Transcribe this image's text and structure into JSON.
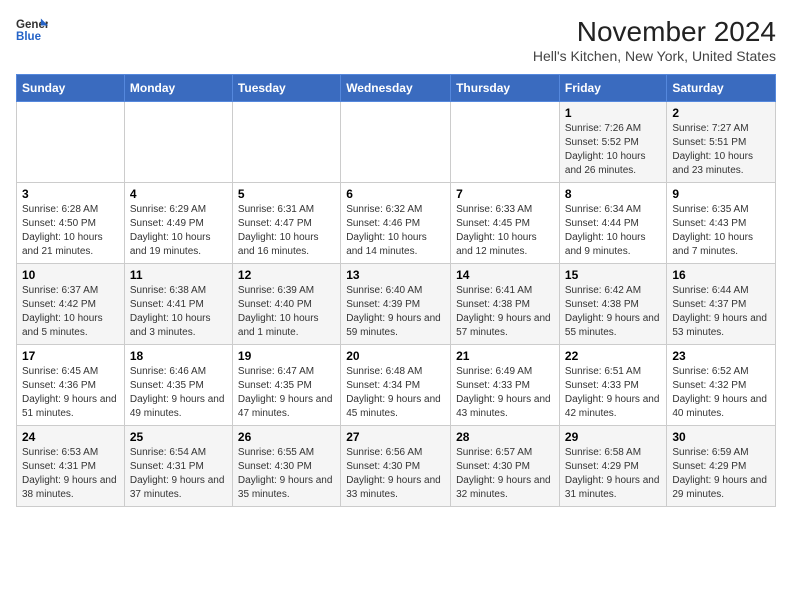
{
  "logo": {
    "line1": "General",
    "line2": "Blue"
  },
  "title": "November 2024",
  "subtitle": "Hell's Kitchen, New York, United States",
  "weekdays": [
    "Sunday",
    "Monday",
    "Tuesday",
    "Wednesday",
    "Thursday",
    "Friday",
    "Saturday"
  ],
  "weeks": [
    [
      {
        "day": "",
        "info": ""
      },
      {
        "day": "",
        "info": ""
      },
      {
        "day": "",
        "info": ""
      },
      {
        "day": "",
        "info": ""
      },
      {
        "day": "",
        "info": ""
      },
      {
        "day": "1",
        "info": "Sunrise: 7:26 AM\nSunset: 5:52 PM\nDaylight: 10 hours and 26 minutes."
      },
      {
        "day": "2",
        "info": "Sunrise: 7:27 AM\nSunset: 5:51 PM\nDaylight: 10 hours and 23 minutes."
      }
    ],
    [
      {
        "day": "3",
        "info": "Sunrise: 6:28 AM\nSunset: 4:50 PM\nDaylight: 10 hours and 21 minutes."
      },
      {
        "day": "4",
        "info": "Sunrise: 6:29 AM\nSunset: 4:49 PM\nDaylight: 10 hours and 19 minutes."
      },
      {
        "day": "5",
        "info": "Sunrise: 6:31 AM\nSunset: 4:47 PM\nDaylight: 10 hours and 16 minutes."
      },
      {
        "day": "6",
        "info": "Sunrise: 6:32 AM\nSunset: 4:46 PM\nDaylight: 10 hours and 14 minutes."
      },
      {
        "day": "7",
        "info": "Sunrise: 6:33 AM\nSunset: 4:45 PM\nDaylight: 10 hours and 12 minutes."
      },
      {
        "day": "8",
        "info": "Sunrise: 6:34 AM\nSunset: 4:44 PM\nDaylight: 10 hours and 9 minutes."
      },
      {
        "day": "9",
        "info": "Sunrise: 6:35 AM\nSunset: 4:43 PM\nDaylight: 10 hours and 7 minutes."
      }
    ],
    [
      {
        "day": "10",
        "info": "Sunrise: 6:37 AM\nSunset: 4:42 PM\nDaylight: 10 hours and 5 minutes."
      },
      {
        "day": "11",
        "info": "Sunrise: 6:38 AM\nSunset: 4:41 PM\nDaylight: 10 hours and 3 minutes."
      },
      {
        "day": "12",
        "info": "Sunrise: 6:39 AM\nSunset: 4:40 PM\nDaylight: 10 hours and 1 minute."
      },
      {
        "day": "13",
        "info": "Sunrise: 6:40 AM\nSunset: 4:39 PM\nDaylight: 9 hours and 59 minutes."
      },
      {
        "day": "14",
        "info": "Sunrise: 6:41 AM\nSunset: 4:38 PM\nDaylight: 9 hours and 57 minutes."
      },
      {
        "day": "15",
        "info": "Sunrise: 6:42 AM\nSunset: 4:38 PM\nDaylight: 9 hours and 55 minutes."
      },
      {
        "day": "16",
        "info": "Sunrise: 6:44 AM\nSunset: 4:37 PM\nDaylight: 9 hours and 53 minutes."
      }
    ],
    [
      {
        "day": "17",
        "info": "Sunrise: 6:45 AM\nSunset: 4:36 PM\nDaylight: 9 hours and 51 minutes."
      },
      {
        "day": "18",
        "info": "Sunrise: 6:46 AM\nSunset: 4:35 PM\nDaylight: 9 hours and 49 minutes."
      },
      {
        "day": "19",
        "info": "Sunrise: 6:47 AM\nSunset: 4:35 PM\nDaylight: 9 hours and 47 minutes."
      },
      {
        "day": "20",
        "info": "Sunrise: 6:48 AM\nSunset: 4:34 PM\nDaylight: 9 hours and 45 minutes."
      },
      {
        "day": "21",
        "info": "Sunrise: 6:49 AM\nSunset: 4:33 PM\nDaylight: 9 hours and 43 minutes."
      },
      {
        "day": "22",
        "info": "Sunrise: 6:51 AM\nSunset: 4:33 PM\nDaylight: 9 hours and 42 minutes."
      },
      {
        "day": "23",
        "info": "Sunrise: 6:52 AM\nSunset: 4:32 PM\nDaylight: 9 hours and 40 minutes."
      }
    ],
    [
      {
        "day": "24",
        "info": "Sunrise: 6:53 AM\nSunset: 4:31 PM\nDaylight: 9 hours and 38 minutes."
      },
      {
        "day": "25",
        "info": "Sunrise: 6:54 AM\nSunset: 4:31 PM\nDaylight: 9 hours and 37 minutes."
      },
      {
        "day": "26",
        "info": "Sunrise: 6:55 AM\nSunset: 4:30 PM\nDaylight: 9 hours and 35 minutes."
      },
      {
        "day": "27",
        "info": "Sunrise: 6:56 AM\nSunset: 4:30 PM\nDaylight: 9 hours and 33 minutes."
      },
      {
        "day": "28",
        "info": "Sunrise: 6:57 AM\nSunset: 4:30 PM\nDaylight: 9 hours and 32 minutes."
      },
      {
        "day": "29",
        "info": "Sunrise: 6:58 AM\nSunset: 4:29 PM\nDaylight: 9 hours and 31 minutes."
      },
      {
        "day": "30",
        "info": "Sunrise: 6:59 AM\nSunset: 4:29 PM\nDaylight: 9 hours and 29 minutes."
      }
    ]
  ]
}
